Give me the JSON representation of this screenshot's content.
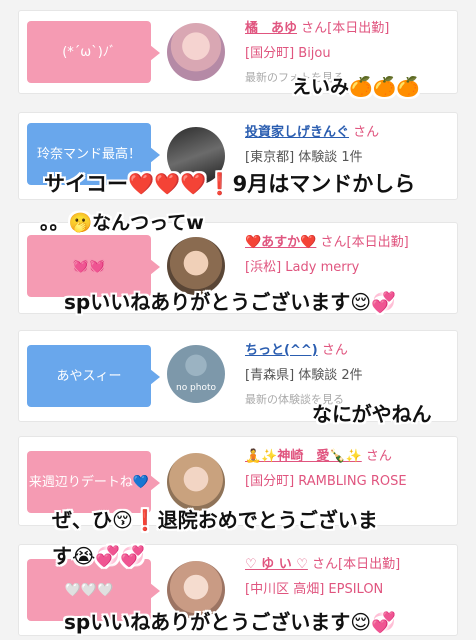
{
  "cards": [
    {
      "bubble": "(*´ω`)ﾉﾞ",
      "name": "橘　あゆ",
      "suffix": "さん[本日出勤]",
      "shop": "[国分町] Bijou",
      "more": "最新のフォトを見る"
    },
    {
      "bubble": "玲奈マンド最高！",
      "name": "投資家しげきんぐ",
      "suffix": "さん",
      "shop": "[東京都] 体験談 1件",
      "more": ""
    },
    {
      "bubble": "💓💓",
      "name": "❤️あすか❤️",
      "suffix": "さん[本日出勤]",
      "shop": "[浜松] Lady merry",
      "more": ""
    },
    {
      "bubble": "あやスィー",
      "name": "ちっと(^^)",
      "suffix": "さん",
      "shop": "[青森県] 体験談 2件",
      "more": "最新の体験談を見る",
      "avatar_text": "no photo"
    },
    {
      "bubble": "来週辺りデートね💙",
      "name": "🧘✨神崎　愛🍾✨",
      "suffix": "さん",
      "shop": "[国分町] RAMBLING ROSE",
      "more": ""
    },
    {
      "bubble": "🤍🤍🤍",
      "name": "♡ ゆ い ♡",
      "suffix": "さん[本日出勤]",
      "shop": "[中川区 高畑] EPSILON",
      "more": ""
    }
  ],
  "overlays": {
    "t1": "えいみ🍊🍊🍊",
    "t2": "サイコー❤️❤️❤️❗️9月はマンドかしら",
    "t3": "。。🫢なんつってw",
    "t4": "spいいねありがとうございます😌💞",
    "t5": "なにがやねん",
    "t6": "ぜ、ひ😚❗️退院おめでとうございま",
    "t7": "す😭💞💞",
    "t8": "spいいねありがとうございます😌💞"
  },
  "colors": {
    "pink_bubble": "#f59bb3",
    "blue_bubble": "#69a7ec",
    "name_pink": "#e0557f",
    "name_blue": "#2a5db0"
  }
}
